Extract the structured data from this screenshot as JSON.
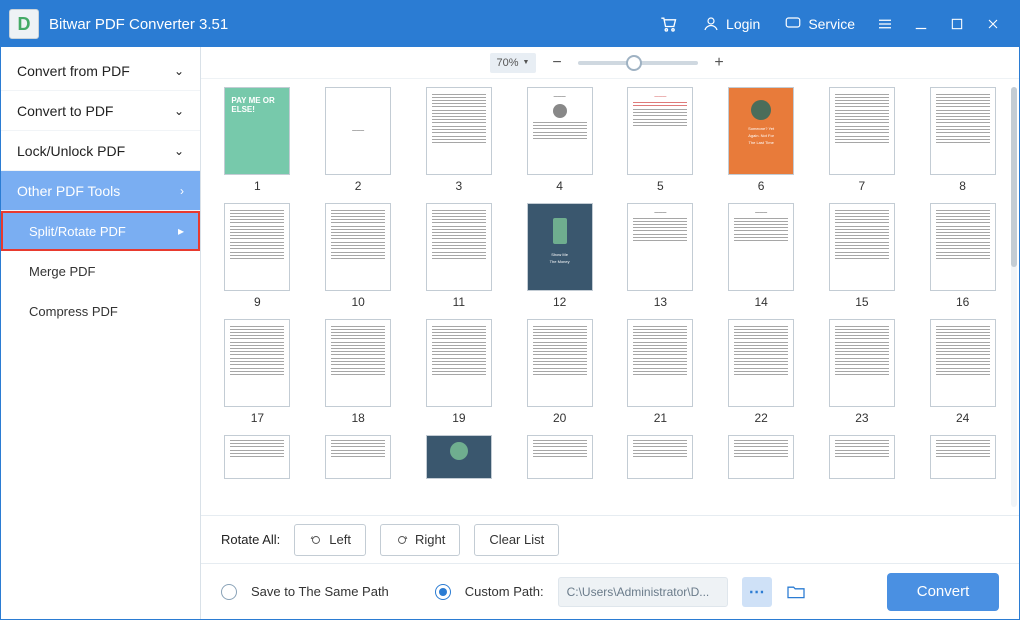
{
  "titlebar": {
    "title": "Bitwar PDF Converter 3.51",
    "login": "Login",
    "service": "Service"
  },
  "sidebar": {
    "groups": [
      {
        "label": "Convert from PDF",
        "active": false
      },
      {
        "label": "Convert to PDF",
        "active": false
      },
      {
        "label": "Lock/Unlock PDF",
        "active": false
      },
      {
        "label": "Other PDF Tools",
        "active": true
      }
    ],
    "subs": [
      {
        "label": "Split/Rotate PDF",
        "active": true
      },
      {
        "label": "Merge PDF",
        "active": false
      },
      {
        "label": "Compress PDF",
        "active": false
      }
    ]
  },
  "zoom": {
    "percent": "70%"
  },
  "pages": {
    "visible_count": 32,
    "labels": [
      "1",
      "2",
      "3",
      "4",
      "5",
      "6",
      "7",
      "8",
      "9",
      "10",
      "11",
      "12",
      "13",
      "14",
      "15",
      "16",
      "17",
      "18",
      "19",
      "20",
      "21",
      "22",
      "23",
      "24",
      "",
      "",
      "",
      "",
      "",
      "",
      "",
      ""
    ]
  },
  "actions": {
    "rotate_all_label": "Rotate All:",
    "left": "Left",
    "right": "Right",
    "clear": "Clear List"
  },
  "path": {
    "save_same": "Save to The Same Path",
    "custom_label": "Custom Path:",
    "value": "C:\\Users\\Administrator\\D...",
    "convert": "Convert"
  },
  "thumb_styles": {
    "1": "cover_green",
    "6": "cover_orange",
    "12": "cover_blue",
    "27": "cover_blue_plain",
    "4": "heading_photo",
    "5": "red_list",
    "13": "heading",
    "14": "heading",
    "2": "title_only"
  },
  "cover_text": {
    "1": "PAY ME OR ELSE!",
    "6_a": "Someone? Yet",
    "6_b": "Again. Not For",
    "6_c": "The Last Time",
    "12_a": "Show Me",
    "12_b": "The Money"
  }
}
